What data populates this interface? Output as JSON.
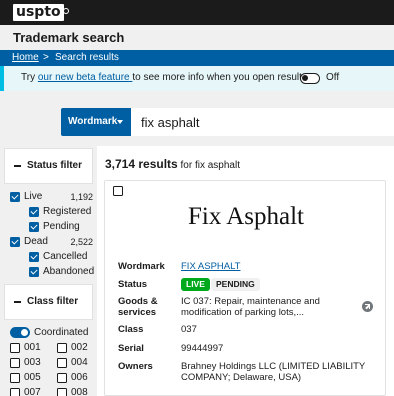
{
  "header": {
    "logo_text": "uspto",
    "app_title": "Trademark search"
  },
  "breadcrumb": {
    "home": "Home",
    "separator": ">",
    "current": "Search results"
  },
  "beta_banner": {
    "prefix": "Try ",
    "link_text": "our new beta feature ",
    "suffix": "to see more info when you open results",
    "toggle_state": "Off"
  },
  "search": {
    "field_button": "Wordmark",
    "query": "fix asphalt"
  },
  "status_filter": {
    "title": "Status filter",
    "items": [
      {
        "label": "Live",
        "count": "1,192",
        "checked": true
      },
      {
        "label": "Registered",
        "checked": true
      },
      {
        "label": "Pending",
        "checked": true
      },
      {
        "label": "Dead",
        "count": "2,522",
        "checked": true
      },
      {
        "label": "Cancelled",
        "checked": true
      },
      {
        "label": "Abandoned",
        "checked": true
      }
    ]
  },
  "class_filter": {
    "title": "Class filter",
    "coordinated_label": "Coordinated",
    "classes": [
      "001",
      "002",
      "003",
      "004",
      "005",
      "006",
      "007",
      "008"
    ]
  },
  "results": {
    "count": "3,714 results",
    "suffix": " for fix asphalt"
  },
  "card": {
    "mark_image_text": "Fix Asphalt",
    "labels": {
      "wordmark": "Wordmark",
      "status": "Status",
      "goods_line1": "Goods &",
      "goods_line2": "services",
      "class": "Class",
      "serial": "Serial",
      "owners": "Owners"
    },
    "wordmark": "FIX ASPHALT",
    "status_live": "LIVE",
    "status_pending": "PENDING",
    "goods_line1": "IC 037: Repair, maintenance and",
    "goods_line2": "modification of parking lots,...",
    "class": "037",
    "serial": "99444997",
    "owners_line1": "Brahney Holdings LLC (LIMITED LIABILITY",
    "owners_line2": "COMPANY; Delaware, USA)"
  },
  "colors": {
    "primary": "#005ea2",
    "live_badge": "#00a91c",
    "banner_accent": "#00bde3",
    "header_bg": "#1b1b1b"
  }
}
